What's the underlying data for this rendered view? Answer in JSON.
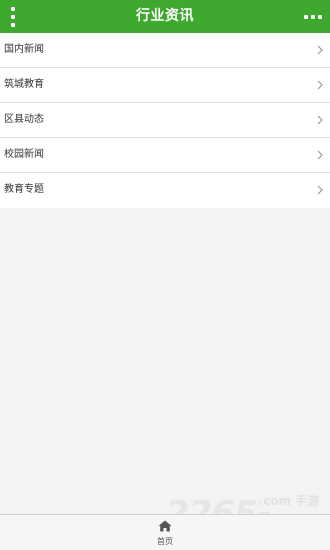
{
  "header": {
    "title": "行业资讯",
    "menu_icon": "kebab-vertical-icon",
    "more_icon": "more-horizontal-icon",
    "color": "#3fa82f"
  },
  "list": {
    "items": [
      {
        "label": "国内新闻"
      },
      {
        "label": "筑城教育"
      },
      {
        "label": "区县动态"
      },
      {
        "label": "校园新闻"
      },
      {
        "label": "教育专题"
      }
    ],
    "chevron_icon": "chevron-right-icon"
  },
  "footer": {
    "home_label": "首页",
    "home_icon": "home-icon"
  },
  "watermark": {
    "number": "2265",
    "text": ".com 手游网"
  }
}
